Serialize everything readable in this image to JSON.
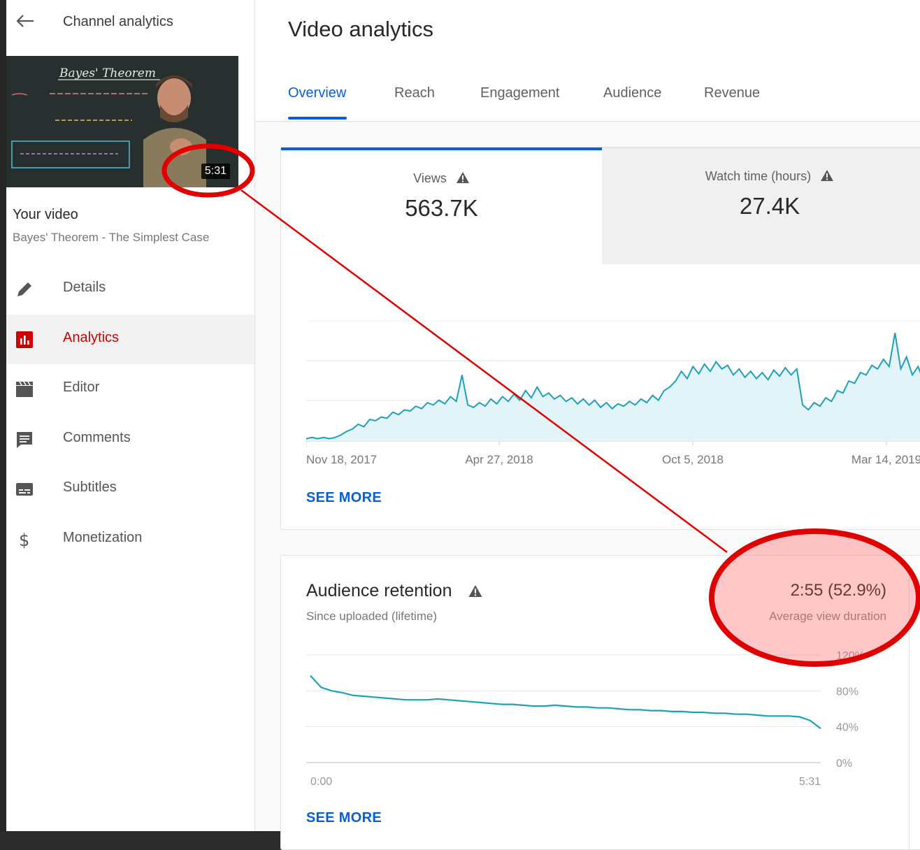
{
  "sidebar": {
    "back_label": "Channel analytics",
    "thumbnail": {
      "board_title": "Bayes' Theorem",
      "duration": "5:31"
    },
    "your_video_label": "Your video",
    "video_title": "Bayes' Theorem - The Simplest Case",
    "items": [
      {
        "label": "Details",
        "icon": "pencil-icon"
      },
      {
        "label": "Analytics",
        "icon": "analytics-icon"
      },
      {
        "label": "Editor",
        "icon": "clapperboard-icon"
      },
      {
        "label": "Comments",
        "icon": "comment-icon"
      },
      {
        "label": "Subtitles",
        "icon": "subtitles-icon"
      },
      {
        "label": "Monetization",
        "icon": "dollar-icon"
      }
    ],
    "active_item": "Analytics"
  },
  "header": {
    "title": "Video analytics",
    "tabs": [
      {
        "label": "Overview"
      },
      {
        "label": "Reach"
      },
      {
        "label": "Engagement"
      },
      {
        "label": "Audience"
      },
      {
        "label": "Revenue"
      }
    ],
    "active_tab": "Overview"
  },
  "overview": {
    "metrics": [
      {
        "label": "Views",
        "value": "563.7K"
      },
      {
        "label": "Watch time (hours)",
        "value": "27.4K"
      }
    ],
    "see_more": "SEE MORE"
  },
  "retention": {
    "title": "Audience retention",
    "subtitle": "Since uploaded (lifetime)",
    "avg_value": "2:55 (52.9%)",
    "avg_label": "Average view duration",
    "see_more": "SEE MORE"
  },
  "colors": {
    "accent_blue": "#065fd4",
    "chart_line": "#1ea0bb",
    "chart_fill": "#e3f4f8",
    "active_red": "#cc0000",
    "annotation_red": "#e00000"
  },
  "chart_data": [
    {
      "type": "area",
      "x_tick_labels": [
        "Nov 18, 2017",
        "Apr 27, 2018",
        "Oct 5, 2018",
        "Mar 14, 2019"
      ],
      "ylim": [
        0,
        1
      ],
      "grid": true,
      "series": [
        {
          "values": [
            0.02,
            0.03,
            0.02,
            0.03,
            0.02,
            0.03,
            0.05,
            0.08,
            0.1,
            0.14,
            0.12,
            0.18,
            0.17,
            0.2,
            0.19,
            0.24,
            0.22,
            0.26,
            0.25,
            0.29,
            0.27,
            0.32,
            0.3,
            0.34,
            0.31,
            0.37,
            0.33,
            0.55,
            0.3,
            0.28,
            0.32,
            0.29,
            0.35,
            0.31,
            0.37,
            0.33,
            0.39,
            0.34,
            0.42,
            0.36,
            0.45,
            0.37,
            0.4,
            0.35,
            0.38,
            0.33,
            0.36,
            0.31,
            0.35,
            0.3,
            0.34,
            0.28,
            0.32,
            0.27,
            0.31,
            0.29,
            0.33,
            0.3,
            0.35,
            0.32,
            0.38,
            0.34,
            0.42,
            0.45,
            0.5,
            0.58,
            0.52,
            0.62,
            0.56,
            0.64,
            0.58,
            0.66,
            0.6,
            0.63,
            0.55,
            0.6,
            0.53,
            0.58,
            0.52,
            0.57,
            0.51,
            0.59,
            0.54,
            0.61,
            0.55,
            0.6,
            0.3,
            0.26,
            0.32,
            0.29,
            0.36,
            0.33,
            0.42,
            0.4,
            0.5,
            0.48,
            0.57,
            0.55,
            0.63,
            0.6,
            0.68,
            0.62,
            0.9,
            0.6,
            0.7,
            0.55,
            0.62,
            0.5,
            0.58,
            0.45
          ]
        }
      ]
    },
    {
      "type": "line",
      "x_tick_labels": [
        "0:00",
        "5:31"
      ],
      "y_tick_labels": [
        "120%",
        "80%",
        "40%",
        "0%"
      ],
      "ylim": [
        0,
        120
      ],
      "grid": true,
      "series": [
        {
          "values": [
            97,
            84,
            80,
            78,
            75,
            74,
            73,
            72,
            71,
            70,
            70,
            70,
            71,
            70,
            69,
            68,
            67,
            66,
            65,
            65,
            64,
            63,
            63,
            64,
            63,
            62,
            62,
            61,
            61,
            60,
            59,
            59,
            58,
            58,
            57,
            57,
            56,
            56,
            55,
            55,
            54,
            54,
            53,
            52,
            52,
            52,
            51,
            47,
            38
          ]
        }
      ]
    }
  ]
}
